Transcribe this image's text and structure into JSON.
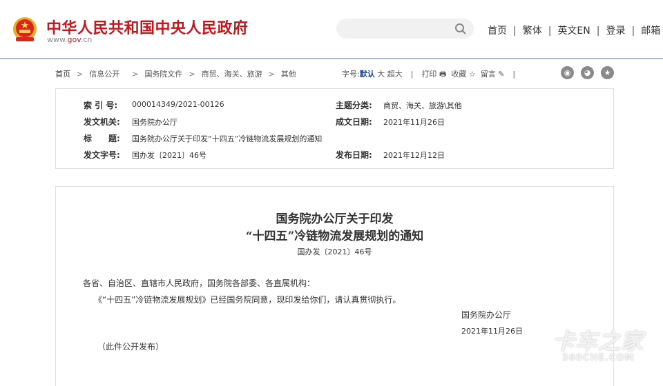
{
  "header": {
    "title": "中华人民共和国中央人民政府",
    "url_prefix": "www.",
    "url_main": "gov",
    "url_suffix": ".cn",
    "search_placeholder": "",
    "nav": [
      "首页",
      "繁体",
      "英文EN",
      "登录",
      "邮箱"
    ]
  },
  "breadcrumb": [
    "首页",
    "信息公开",
    "国务院文件",
    "商贸、海关、旅游",
    "其他"
  ],
  "tools": {
    "font_label": "字号:",
    "font_default": "默认",
    "font_large": "大",
    "font_xlarge": "超大",
    "print": "打印",
    "favorite": "收藏",
    "comment": "留言"
  },
  "info": {
    "index_label": "索 引 号:",
    "index_value": "000014349/2021-00126",
    "topic_label": "主题分类:",
    "topic_value": "商贸、海关、旅游\\其他",
    "issuer_label": "发文机关:",
    "issuer_value": "国务院办公厅",
    "written_label": "成文日期:",
    "written_value": "2021年11月26日",
    "title_label": "标　　题:",
    "title_value": "国务院办公厅关于印发“十四五”冷链物流发展规划的通知",
    "docno_label": "发文字号:",
    "docno_value": "国办发〔2021〕46号",
    "published_label": "发布日期:",
    "published_value": "2021年12月12日"
  },
  "document": {
    "title_line1": "国务院办公厅关于印发",
    "title_line2": "“十四五”冷链物流发展规划的通知",
    "number": "国办发〔2021〕46号",
    "salutation": "各省、自治区、直辖市人民政府，国务院各部委、各直属机构：",
    "paragraph": "《“十四五”冷链物流发展规划》已经国务院同意，现印发给你们，请认真贯彻执行。",
    "signer": "国务院办公厅",
    "date": "2021年11月26日",
    "note": "（此件公开发布）"
  },
  "watermark": {
    "line1": "卡车之家",
    "line2": "360CHE.COM"
  }
}
